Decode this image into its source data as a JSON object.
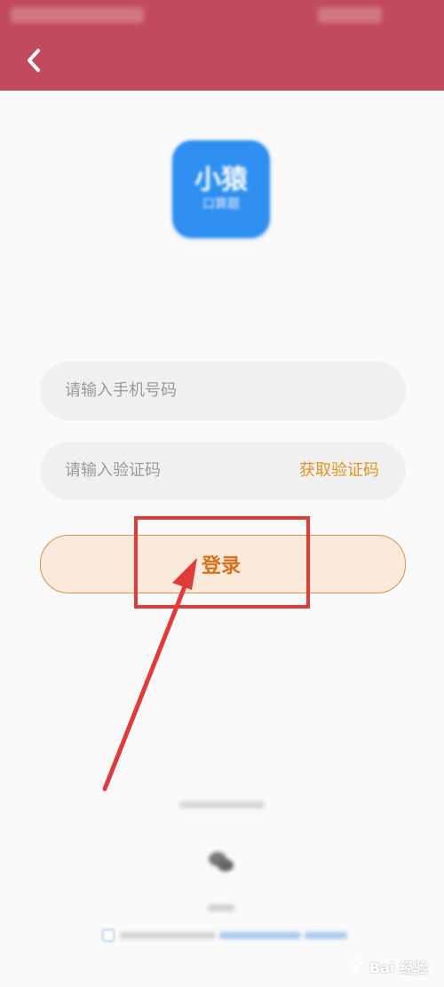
{
  "header": {
    "back_icon": "chevron-left-icon",
    "color": "#c14a5e"
  },
  "app_logo": {
    "title": "小猿",
    "subtitle": "口算题"
  },
  "form": {
    "phone_placeholder": "请输入手机号码",
    "code_placeholder": "请输入验证码",
    "get_code_label": "获取验证码",
    "login_label": "登录"
  },
  "annotation": {
    "highlight_color": "#e03a3a"
  },
  "watermark": {
    "text": "Bai 经验"
  }
}
